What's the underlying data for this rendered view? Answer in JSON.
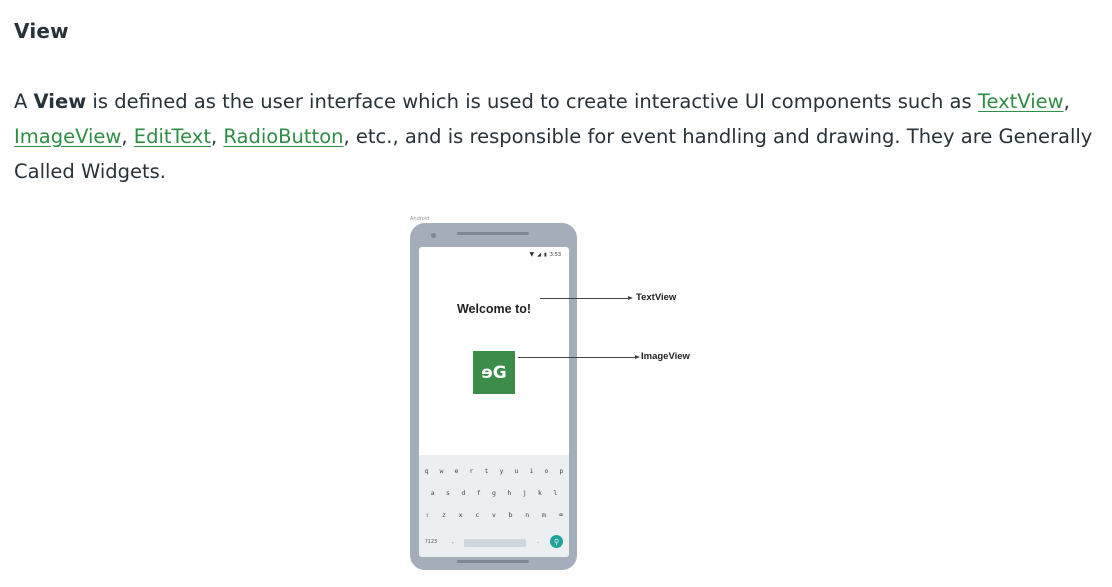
{
  "section": {
    "heading": "View"
  },
  "paragraph": {
    "intro_a": "A ",
    "bold_term": "View",
    "intro_b": " is defined as the user interface which is used to create interactive UI components such as ",
    "links": [
      "TextView",
      "ImageView",
      "EditText",
      "RadioButton"
    ],
    "sep": ", ",
    "outro": ", etc., and is responsible for event handling and drawing. They are Generally Called Widgets."
  },
  "figure": {
    "android_label": "Android",
    "status_time": "3:53",
    "welcome_text": "Welcome to!",
    "logo_text": "ɘG",
    "callouts": {
      "textview": "TextView",
      "imageview": "ImageView"
    },
    "keyboard": {
      "row1": [
        "q",
        "w",
        "e",
        "r",
        "t",
        "y",
        "u",
        "i",
        "o",
        "p"
      ],
      "row2": [
        "a",
        "s",
        "d",
        "f",
        "g",
        "h",
        "j",
        "k",
        "l"
      ],
      "row3": [
        "⇧",
        "z",
        "x",
        "c",
        "v",
        "b",
        "n",
        "m",
        "⌫"
      ],
      "key_123": "?123",
      "key_comma": ",",
      "key_dot": "."
    },
    "colors": {
      "phone_body": "#a3aeba",
      "logo_bg": "#3c8c4a",
      "search_key": "#22a39a",
      "link": "#2f8d46"
    }
  }
}
